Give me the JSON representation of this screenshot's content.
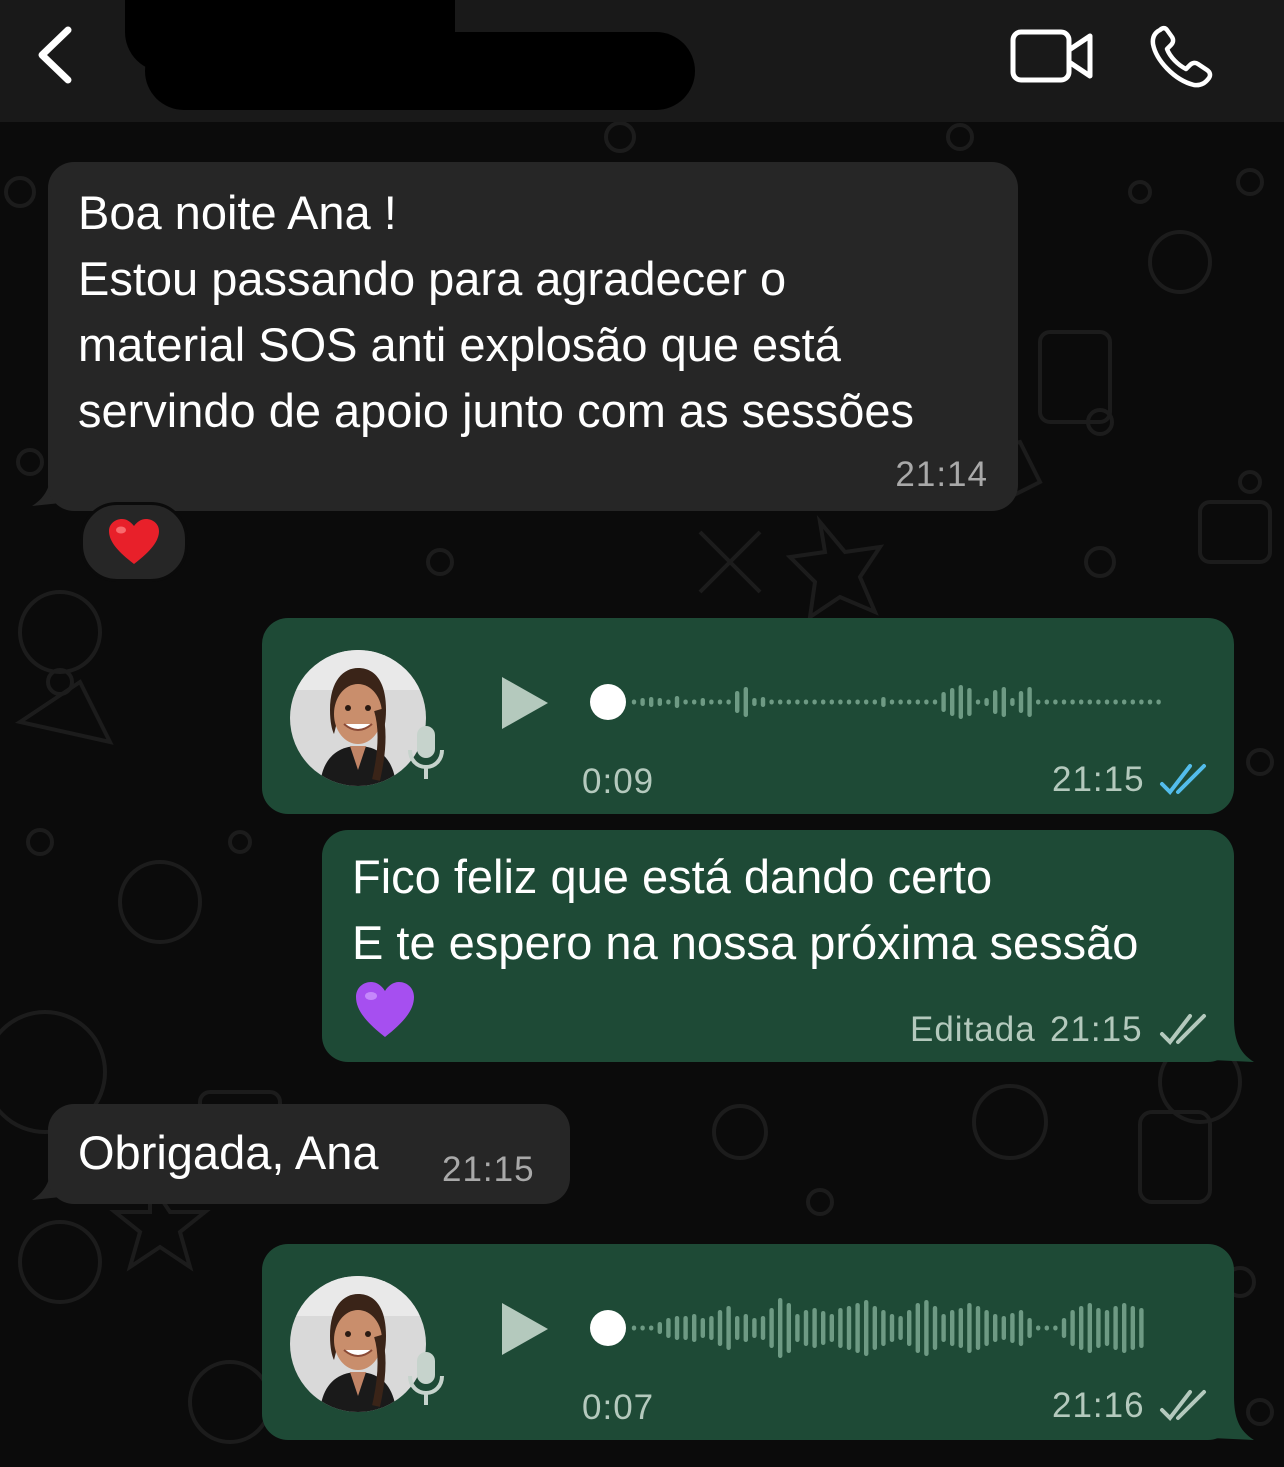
{
  "header": {
    "back_icon": "chevron-left-icon",
    "video_icon": "video-camera-icon",
    "phone_icon": "phone-icon"
  },
  "messages": [
    {
      "direction": "incoming",
      "text": "Boa noite Ana !\nEstou passando para agradecer o\nmaterial SOS anti explosão que está\nservindo de apoio junto com as sessões",
      "time": "21:14",
      "reaction": "❤️"
    },
    {
      "direction": "outgoing",
      "type": "voice",
      "duration": "0:09",
      "time": "21:15",
      "read": true
    },
    {
      "direction": "outgoing",
      "text": "Fico feliz que está dando certo\nE te espero na nossa próxima sessão",
      "emoji": "💜",
      "edited_label": "Editada",
      "time": "21:15",
      "read": false
    },
    {
      "direction": "incoming",
      "text": "Obrigada, Ana",
      "time": "21:15"
    },
    {
      "direction": "outgoing",
      "type": "voice",
      "duration": "0:07",
      "time": "21:16",
      "read": false
    }
  ],
  "colors": {
    "incoming_bubble": "#262626",
    "outgoing_bubble": "#1e4a36",
    "read_ticks": "#53bdeb",
    "delivered_ticks": "#b4c9bd"
  }
}
